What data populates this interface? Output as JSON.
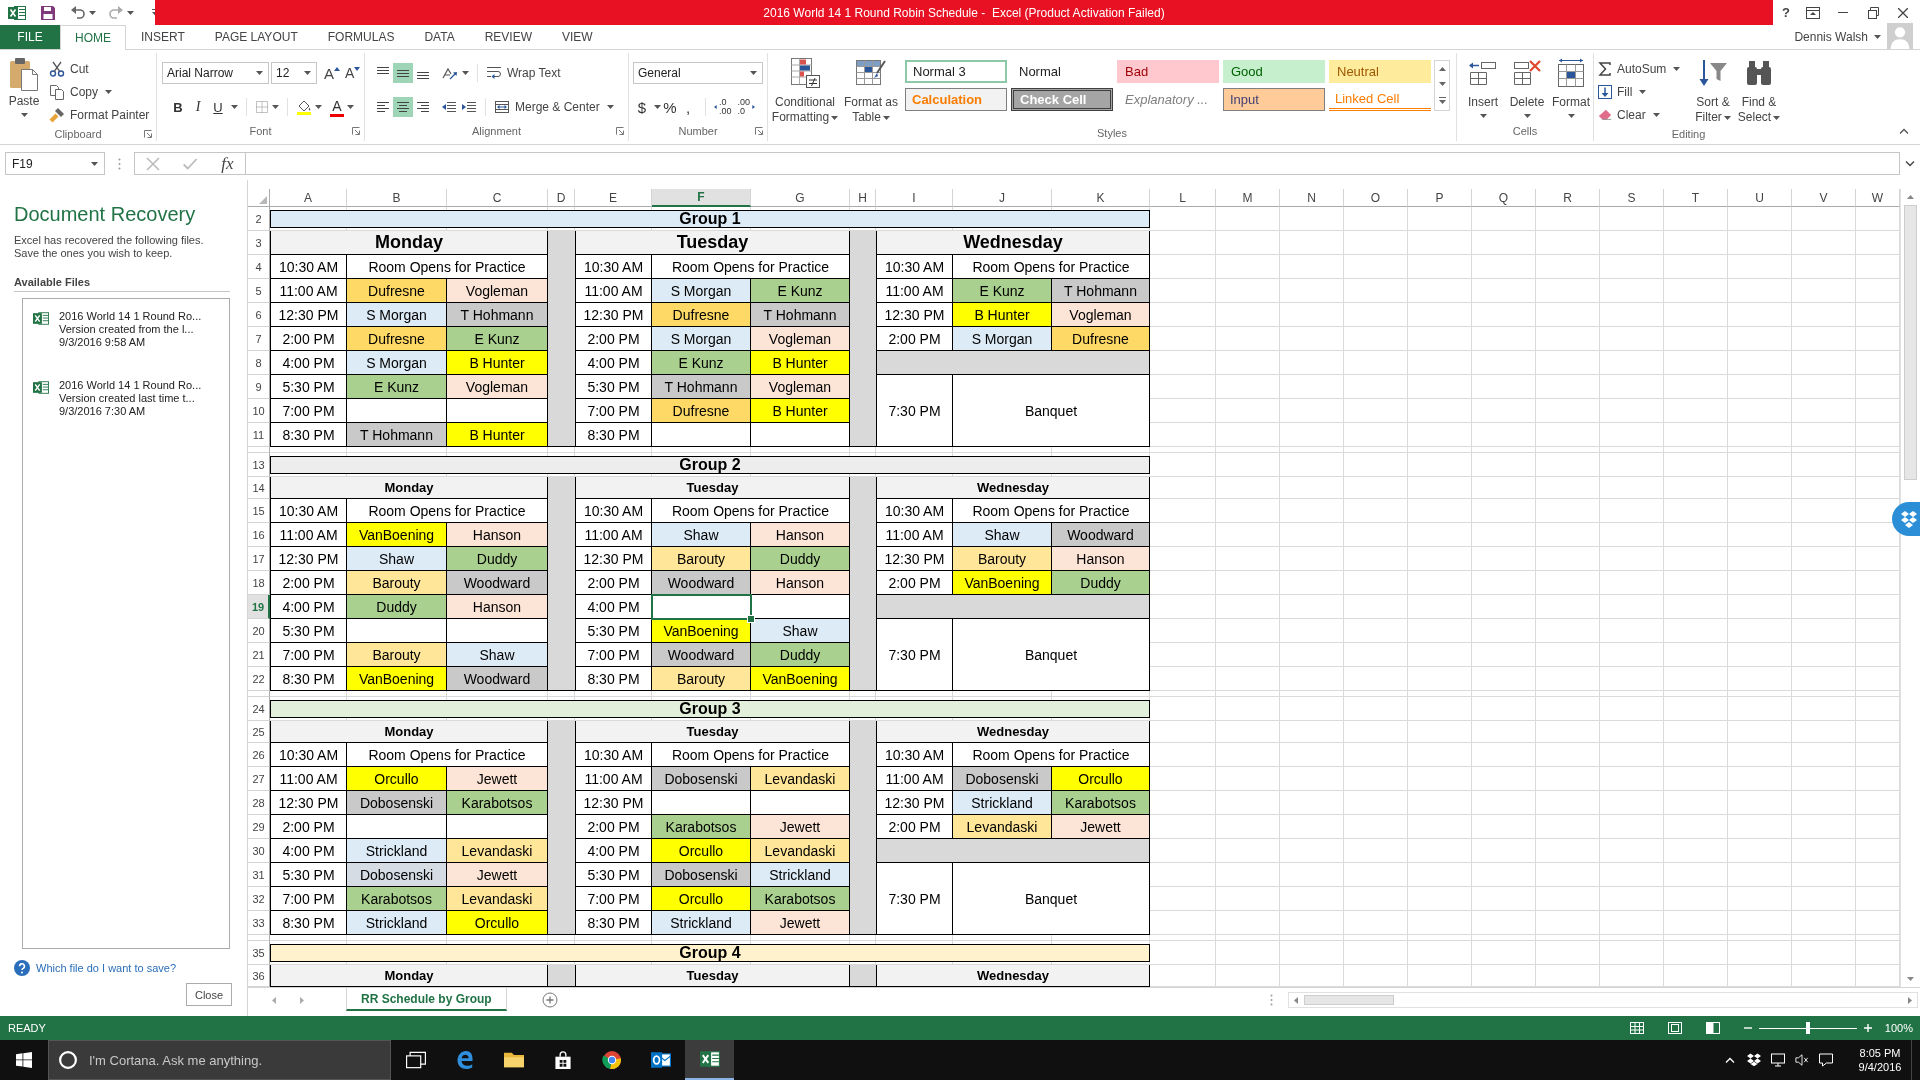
{
  "window": {
    "title": "2016 World 14 1 Round Robin Schedule -  Excel (Product Activation Failed)",
    "help": "?"
  },
  "tabs": [
    {
      "label": "FILE",
      "kind": "file",
      "selected": false
    },
    {
      "label": "HOME",
      "kind": "tab",
      "selected": true
    },
    {
      "label": "INSERT",
      "kind": "tab",
      "selected": false
    },
    {
      "label": "PAGE LAYOUT",
      "kind": "tab",
      "selected": false
    },
    {
      "label": "FORMULAS",
      "kind": "tab",
      "selected": false
    },
    {
      "label": "DATA",
      "kind": "tab",
      "selected": false
    },
    {
      "label": "REVIEW",
      "kind": "tab",
      "selected": false
    },
    {
      "label": "VIEW",
      "kind": "tab",
      "selected": false
    }
  ],
  "account": {
    "name": "Dennis Walsh"
  },
  "clipboard": {
    "label": "Clipboard",
    "paste": "Paste",
    "cut": "Cut",
    "copy": "Copy",
    "format_painter": "Format Painter"
  },
  "font": {
    "label": "Font",
    "name": "Arial Narrow",
    "size": "12",
    "grow": "A",
    "shrink": "A",
    "bold": "B",
    "italic": "I",
    "underline": "U",
    "color_button": "A"
  },
  "alignment": {
    "label": "Alignment",
    "vertical": [
      {
        "selected": false
      },
      {
        "selected": true
      },
      {
        "selected": false
      }
    ],
    "horizontal": [
      {
        "selected": false
      },
      {
        "selected": true
      },
      {
        "selected": false
      }
    ],
    "wrap": "Wrap Text",
    "merge": "Merge & Center"
  },
  "number": {
    "label": "Number",
    "format": "General",
    "currency": "$",
    "percent": "%",
    "comma": ",",
    "increase_decimal": [
      ".0",
      ".00"
    ],
    "decrease_decimal": [
      ".00",
      ".0"
    ]
  },
  "styles": {
    "label": "Styles",
    "conditional": [
      "Conditional",
      "Formatting"
    ],
    "table": [
      "Format as",
      "Table"
    ],
    "gallery": [
      {
        "label": "Normal 3",
        "kind": "normal",
        "selected": true
      },
      {
        "label": "Normal",
        "kind": "normal",
        "selected": false
      },
      {
        "label": "Bad",
        "kind": "bad",
        "selected": false
      },
      {
        "label": "Good",
        "kind": "good",
        "selected": false
      },
      {
        "label": "Neutral",
        "kind": "neutral",
        "selected": false
      },
      {
        "label": "Calculation",
        "kind": "calculation",
        "selected": false
      },
      {
        "label": "Check Cell",
        "kind": "check",
        "selected": false
      },
      {
        "label": "Explanatory ...",
        "kind": "explanatory",
        "selected": false
      },
      {
        "label": "Input",
        "kind": "input",
        "selected": false
      },
      {
        "label": "Linked Cell",
        "kind": "linked",
        "selected": false
      }
    ]
  },
  "cells": {
    "label": "Cells",
    "buttons": [
      {
        "label": "Insert",
        "kind": "insert"
      },
      {
        "label": "Delete",
        "kind": "delete"
      },
      {
        "label": "Format",
        "kind": "format"
      }
    ]
  },
  "editing": {
    "label": "Editing",
    "autosum": "AutoSum",
    "fill": "Fill",
    "clear": "Clear",
    "sort": [
      "Sort &",
      "Filter"
    ],
    "find": [
      "Find &",
      "Select"
    ]
  },
  "formula_bar": {
    "name_box": "F19",
    "fx": "fx"
  },
  "recovery": {
    "title": "Document Recovery",
    "message": "Excel has recovered the following files. Save the ones you wish to keep.",
    "files_heading": "Available Files",
    "files": [
      {
        "name": "2016 World 14 1 Round Ro...",
        "description": "Version created from the l...",
        "time": "9/3/2016 9:58 AM"
      },
      {
        "name": "2016 World 14 1 Round Ro...",
        "description": "Version created last time t...",
        "time": "9/3/2016 7:30 AM"
      }
    ],
    "help_link": "Which file do I want to save?",
    "close": "Close"
  },
  "sheet": {
    "columns": [
      {
        "label": "A",
        "selected": false
      },
      {
        "label": "B",
        "selected": false
      },
      {
        "label": "C",
        "selected": false
      },
      {
        "label": "D",
        "selected": false
      },
      {
        "label": "E",
        "selected": false
      },
      {
        "label": "F",
        "selected": true
      },
      {
        "label": "G",
        "selected": false
      },
      {
        "label": "H",
        "selected": false
      },
      {
        "label": "I",
        "selected": false
      },
      {
        "label": "J",
        "selected": false
      },
      {
        "label": "K",
        "selected": false
      },
      {
        "label": "L",
        "selected": false
      },
      {
        "label": "M",
        "selected": false
      },
      {
        "label": "N",
        "selected": false
      },
      {
        "label": "O",
        "selected": false
      },
      {
        "label": "P",
        "selected": false
      },
      {
        "label": "Q",
        "selected": false
      },
      {
        "label": "R",
        "selected": false
      },
      {
        "label": "S",
        "selected": false
      },
      {
        "label": "T",
        "selected": false
      },
      {
        "label": "U",
        "selected": false
      },
      {
        "label": "V",
        "selected": false
      },
      {
        "label": "W",
        "selected": false
      }
    ],
    "rows": [
      {
        "label": "2",
        "selected": false
      },
      {
        "label": "3",
        "selected": false
      },
      {
        "label": "4",
        "selected": false
      },
      {
        "label": "5",
        "selected": false
      },
      {
        "label": "6",
        "selected": false
      },
      {
        "label": "7",
        "selected": false
      },
      {
        "label": "8",
        "selected": false
      },
      {
        "label": "9",
        "selected": false
      },
      {
        "label": "10",
        "selected": false
      },
      {
        "label": "11",
        "selected": false
      },
      {
        "selected": false
      },
      {
        "label": "13",
        "selected": false
      },
      {
        "label": "14",
        "selected": false
      },
      {
        "label": "15",
        "selected": false
      },
      {
        "label": "16",
        "selected": false
      },
      {
        "label": "17",
        "selected": false
      },
      {
        "label": "18",
        "selected": false
      },
      {
        "label": "19",
        "selected": true
      },
      {
        "label": "20",
        "selected": false
      },
      {
        "label": "21",
        "selected": false
      },
      {
        "label": "22",
        "selected": false
      },
      {
        "selected": false
      },
      {
        "label": "24",
        "selected": false
      },
      {
        "label": "25",
        "selected": false
      },
      {
        "label": "26",
        "selected": false
      },
      {
        "label": "27",
        "selected": false
      },
      {
        "label": "28",
        "selected": false
      },
      {
        "label": "29",
        "selected": false
      },
      {
        "label": "30",
        "selected": false
      },
      {
        "label": "31",
        "selected": false
      },
      {
        "label": "32",
        "selected": false
      },
      {
        "label": "33",
        "selected": false
      },
      {
        "selected": false
      },
      {
        "label": "35",
        "selected": false
      },
      {
        "label": "36",
        "selected": false
      }
    ]
  },
  "groups": [
    {
      "title": "Group 1",
      "color": "#ddebf7",
      "days": [
        {
          "name": "Monday",
          "slots": [
            {
              "kind": "practice",
              "time": "10:30 AM",
              "text": "Room Opens for Practice"
            },
            {
              "kind": "match",
              "time": "11:00 AM",
              "players": [
                {
                  "name": "Dufresne",
                  "color": "#ffd966"
                },
                {
                  "name": "Vogleman",
                  "color": "#fce4d6"
                }
              ]
            },
            {
              "kind": "match",
              "time": "12:30 PM",
              "players": [
                {
                  "name": "S Morgan",
                  "color": "#ddebf7"
                },
                {
                  "name": "T Hohmann",
                  "color": "#c9c9c9"
                }
              ]
            },
            {
              "kind": "match",
              "time": "2:00 PM",
              "players": [
                {
                  "name": "Dufresne",
                  "color": "#ffd966"
                },
                {
                  "name": "E Kunz",
                  "color": "#a9d08e"
                }
              ]
            },
            {
              "kind": "match",
              "time": "4:00 PM",
              "players": [
                {
                  "name": "S Morgan",
                  "color": "#ddebf7"
                },
                {
                  "name": "B Hunter",
                  "color": "#ffff00"
                }
              ]
            },
            {
              "kind": "match",
              "time": "5:30 PM",
              "players": [
                {
                  "name": "E Kunz",
                  "color": "#a9d08e"
                },
                {
                  "name": "Vogleman",
                  "color": "#fce4d6"
                }
              ]
            },
            {
              "kind": "open",
              "time": "7:00 PM"
            },
            {
              "kind": "match",
              "time": "8:30 PM",
              "players": [
                {
                  "name": "T Hohmann",
                  "color": "#c9c9c9"
                },
                {
                  "name": "B Hunter",
                  "color": "#ffff00"
                }
              ]
            }
          ]
        },
        {
          "name": "Tuesday",
          "slots": [
            {
              "kind": "practice",
              "time": "10:30 AM",
              "text": "Room Opens for Practice"
            },
            {
              "kind": "match",
              "time": "11:00 AM",
              "players": [
                {
                  "name": "S Morgan",
                  "color": "#ddebf7"
                },
                {
                  "name": "E Kunz",
                  "color": "#a9d08e"
                }
              ]
            },
            {
              "kind": "match",
              "time": "12:30 PM",
              "players": [
                {
                  "name": "Dufresne",
                  "color": "#ffd966"
                },
                {
                  "name": "T Hohmann",
                  "color": "#c9c9c9"
                }
              ]
            },
            {
              "kind": "match",
              "time": "2:00 PM",
              "players": [
                {
                  "name": "S Morgan",
                  "color": "#ddebf7"
                },
                {
                  "name": "Vogleman",
                  "color": "#fce4d6"
                }
              ]
            },
            {
              "kind": "match",
              "time": "4:00 PM",
              "players": [
                {
                  "name": "E Kunz",
                  "color": "#a9d08e"
                },
                {
                  "name": "B Hunter",
                  "color": "#ffff00"
                }
              ]
            },
            {
              "kind": "match",
              "time": "5:30 PM",
              "players": [
                {
                  "name": "T Hohmann",
                  "color": "#c9c9c9"
                },
                {
                  "name": "Vogleman",
                  "color": "#fce4d6"
                }
              ]
            },
            {
              "kind": "match",
              "time": "7:00 PM",
              "players": [
                {
                  "name": "Dufresne",
                  "color": "#ffd966"
                },
                {
                  "name": "B Hunter",
                  "color": "#ffff00"
                }
              ]
            },
            {
              "kind": "open",
              "time": "8:30 PM"
            }
          ]
        },
        {
          "name": "Wednesday",
          "slots": [
            {
              "kind": "practice",
              "time": "10:30 AM",
              "text": "Room Opens for Practice"
            },
            {
              "kind": "match",
              "time": "11:00 AM",
              "players": [
                {
                  "name": "E Kunz",
                  "color": "#a9d08e"
                },
                {
                  "name": "T Hohmann",
                  "color": "#c9c9c9"
                }
              ]
            },
            {
              "kind": "match",
              "time": "12:30 PM",
              "players": [
                {
                  "name": "B Hunter",
                  "color": "#ffff00"
                },
                {
                  "name": "Vogleman",
                  "color": "#fce4d6"
                }
              ]
            },
            {
              "kind": "match",
              "time": "2:00 PM",
              "players": [
                {
                  "name": "S Morgan",
                  "color": "#ddebf7"
                },
                {
                  "name": "Dufresne",
                  "color": "#ffd966"
                }
              ]
            },
            {
              "kind": "break"
            },
            {
              "kind": "banquet",
              "time": "7:30 PM",
              "text": "Banquet"
            }
          ]
        }
      ]
    },
    {
      "title": "Group 2",
      "color": "#ededed",
      "days": [
        {
          "name": "Monday",
          "slots": [
            {
              "kind": "practice",
              "time": "10:30 AM",
              "text": "Room Opens for Practice"
            },
            {
              "kind": "match",
              "time": "11:00 AM",
              "players": [
                {
                  "name": "VanBoening",
                  "color": "#ffff00"
                },
                {
                  "name": "Hanson",
                  "color": "#fce4d6"
                }
              ]
            },
            {
              "kind": "match",
              "time": "12:30 PM",
              "players": [
                {
                  "name": "Shaw",
                  "color": "#ddebf7"
                },
                {
                  "name": "Duddy",
                  "color": "#a9d08e"
                }
              ]
            },
            {
              "kind": "match",
              "time": "2:00 PM",
              "players": [
                {
                  "name": "Barouty",
                  "color": "#ffe699"
                },
                {
                  "name": "Woodward",
                  "color": "#c9c9c9"
                }
              ]
            },
            {
              "kind": "match",
              "time": "4:00 PM",
              "players": [
                {
                  "name": "Duddy",
                  "color": "#a9d08e"
                },
                {
                  "name": "Hanson",
                  "color": "#fce4d6"
                }
              ]
            },
            {
              "kind": "open",
              "time": "5:30 PM"
            },
            {
              "kind": "match",
              "time": "7:00 PM",
              "players": [
                {
                  "name": "Barouty",
                  "color": "#ffe699"
                },
                {
                  "name": "Shaw",
                  "color": "#ddebf7"
                }
              ]
            },
            {
              "kind": "match",
              "time": "8:30 PM",
              "players": [
                {
                  "name": "VanBoening",
                  "color": "#ffff00"
                },
                {
                  "name": "Woodward",
                  "color": "#c9c9c9"
                }
              ]
            }
          ]
        },
        {
          "name": "Tuesday",
          "slots": [
            {
              "kind": "practice",
              "time": "10:30 AM",
              "text": "Room Opens for Practice"
            },
            {
              "kind": "match",
              "time": "11:00 AM",
              "players": [
                {
                  "name": "Shaw",
                  "color": "#ddebf7"
                },
                {
                  "name": "Hanson",
                  "color": "#fce4d6"
                }
              ]
            },
            {
              "kind": "match",
              "time": "12:30 PM",
              "players": [
                {
                  "name": "Barouty",
                  "color": "#ffe699"
                },
                {
                  "name": "Duddy",
                  "color": "#a9d08e"
                }
              ]
            },
            {
              "kind": "match",
              "time": "2:00 PM",
              "players": [
                {
                  "name": "Woodward",
                  "color": "#c9c9c9"
                },
                {
                  "name": "Hanson",
                  "color": "#fce4d6"
                }
              ]
            },
            {
              "kind": "open",
              "time": "4:00 PM"
            },
            {
              "kind": "match",
              "time": "5:30 PM",
              "players": [
                {
                  "name": "VanBoening",
                  "color": "#ffff00"
                },
                {
                  "name": "Shaw",
                  "color": "#ddebf7"
                }
              ]
            },
            {
              "kind": "match",
              "time": "7:00 PM",
              "players": [
                {
                  "name": "Woodward",
                  "color": "#c9c9c9"
                },
                {
                  "name": "Duddy",
                  "color": "#a9d08e"
                }
              ]
            },
            {
              "kind": "match",
              "time": "8:30 PM",
              "players": [
                {
                  "name": "Barouty",
                  "color": "#ffe699"
                },
                {
                  "name": "VanBoening",
                  "color": "#ffff00"
                }
              ]
            }
          ]
        },
        {
          "name": "Wednesday",
          "slots": [
            {
              "kind": "practice",
              "time": "10:30 AM",
              "text": "Room Opens for Practice"
            },
            {
              "kind": "match",
              "time": "11:00 AM",
              "players": [
                {
                  "name": "Shaw",
                  "color": "#ddebf7"
                },
                {
                  "name": "Woodward",
                  "color": "#c9c9c9"
                }
              ]
            },
            {
              "kind": "match",
              "time": "12:30 PM",
              "players": [
                {
                  "name": "Barouty",
                  "color": "#ffe699"
                },
                {
                  "name": "Hanson",
                  "color": "#fce4d6"
                }
              ]
            },
            {
              "kind": "match",
              "time": "2:00 PM",
              "players": [
                {
                  "name": "VanBoening",
                  "color": "#ffff00"
                },
                {
                  "name": "Duddy",
                  "color": "#a9d08e"
                }
              ]
            },
            {
              "kind": "break"
            },
            {
              "kind": "banquet",
              "time": "7:30 PM",
              "text": "Banquet"
            }
          ]
        }
      ]
    },
    {
      "title": "Group 3",
      "color": "#e2efda",
      "days": [
        {
          "name": "Monday",
          "slots": [
            {
              "kind": "practice",
              "time": "10:30 AM",
              "text": "Room Opens for Practice"
            },
            {
              "kind": "match",
              "time": "11:00 AM",
              "players": [
                {
                  "name": "Orcullo",
                  "color": "#ffff00"
                },
                {
                  "name": "Jewett",
                  "color": "#fce4d6"
                }
              ]
            },
            {
              "kind": "match",
              "time": "12:30 PM",
              "players": [
                {
                  "name": "Dobosenski",
                  "color": "#c9c9c9"
                },
                {
                  "name": "Karabotsos",
                  "color": "#a9d08e"
                }
              ]
            },
            {
              "kind": "open",
              "time": "2:00 PM"
            },
            {
              "kind": "match",
              "time": "4:00 PM",
              "players": [
                {
                  "name": "Strickland",
                  "color": "#ddebf7"
                },
                {
                  "name": "Levandaski",
                  "color": "#ffe699"
                }
              ]
            },
            {
              "kind": "match",
              "time": "5:30 PM",
              "players": [
                {
                  "name": "Dobosenski",
                  "color": "#d6dce4"
                },
                {
                  "name": "Jewett",
                  "color": "#fce4d6"
                }
              ]
            },
            {
              "kind": "match",
              "time": "7:00 PM",
              "players": [
                {
                  "name": "Karabotsos",
                  "color": "#a9d08e"
                },
                {
                  "name": "Levandaski",
                  "color": "#ffe699"
                }
              ]
            },
            {
              "kind": "match",
              "time": "8:30 PM",
              "players": [
                {
                  "name": "Strickland",
                  "color": "#ddebf7"
                },
                {
                  "name": "Orcullo",
                  "color": "#ffff00"
                }
              ]
            }
          ]
        },
        {
          "name": "Tuesday",
          "slots": [
            {
              "kind": "practice",
              "time": "10:30 AM",
              "text": "Room Opens for Practice"
            },
            {
              "kind": "match",
              "time": "11:00 AM",
              "players": [
                {
                  "name": "Dobosenski",
                  "color": "#c9c9c9"
                },
                {
                  "name": "Levandaski",
                  "color": "#ffe699"
                }
              ]
            },
            {
              "kind": "open",
              "time": "12:30 PM"
            },
            {
              "kind": "match",
              "time": "2:00 PM",
              "players": [
                {
                  "name": "Karabotsos",
                  "color": "#a9d08e"
                },
                {
                  "name": "Jewett",
                  "color": "#fce4d6"
                }
              ]
            },
            {
              "kind": "match",
              "time": "4:00 PM",
              "players": [
                {
                  "name": "Orcullo",
                  "color": "#ffff00"
                },
                {
                  "name": "Levandaski",
                  "color": "#ffe699"
                }
              ]
            },
            {
              "kind": "match",
              "time": "5:30 PM",
              "players": [
                {
                  "name": "Dobosenski",
                  "color": "#c9c9c9"
                },
                {
                  "name": "Strickland",
                  "color": "#ddebf7"
                }
              ]
            },
            {
              "kind": "match",
              "time": "7:00 PM",
              "players": [
                {
                  "name": "Orcullo",
                  "color": "#ffff00"
                },
                {
                  "name": "Karabotsos",
                  "color": "#a9d08e"
                }
              ]
            },
            {
              "kind": "match",
              "time": "8:30 PM",
              "players": [
                {
                  "name": "Strickland",
                  "color": "#ddebf7"
                },
                {
                  "name": "Jewett",
                  "color": "#fce4d6"
                }
              ]
            }
          ]
        },
        {
          "name": "Wednesday",
          "slots": [
            {
              "kind": "practice",
              "time": "10:30 AM",
              "text": "Room Opens for Practice"
            },
            {
              "kind": "match",
              "time": "11:00 AM",
              "players": [
                {
                  "name": "Dobosenski",
                  "color": "#c9c9c9"
                },
                {
                  "name": "Orcullo",
                  "color": "#ffff00"
                }
              ]
            },
            {
              "kind": "match",
              "time": "12:30 PM",
              "players": [
                {
                  "name": "Strickland",
                  "color": "#ddebf7"
                },
                {
                  "name": "Karabotsos",
                  "color": "#a9d08e"
                }
              ]
            },
            {
              "kind": "match",
              "time": "2:00 PM",
              "players": [
                {
                  "name": "Levandaski",
                  "color": "#ffe699"
                },
                {
                  "name": "Jewett",
                  "color": "#fce4d6"
                }
              ]
            },
            {
              "kind": "break"
            },
            {
              "kind": "banquet",
              "time": "7:30 PM",
              "text": "Banquet"
            }
          ]
        }
      ]
    },
    {
      "title": "Group 4",
      "color": "#fff2cc",
      "days": [
        {
          "name": "Monday"
        },
        {
          "name": "Tuesday"
        },
        {
          "name": "Wednesday"
        }
      ]
    }
  ],
  "sheet_tabs": [
    {
      "label": "RR Schedule by Group",
      "selected": true
    }
  ],
  "status_bar": {
    "mode": "READY",
    "zoom_slider": {
      "level": 0.5
    },
    "zoom": "100%"
  },
  "taskbar": {
    "search": {
      "placeholder": "I'm Cortana. Ask me anything."
    },
    "apps": [
      {
        "kind": "edge",
        "selected": false
      },
      {
        "kind": "explorer",
        "selected": false
      },
      {
        "kind": "store",
        "selected": false
      },
      {
        "kind": "chrome",
        "selected": false
      },
      {
        "kind": "outlook",
        "selected": false
      },
      {
        "kind": "excel",
        "selected": true
      }
    ],
    "time": "8:05 PM",
    "date": "9/4/2016"
  }
}
